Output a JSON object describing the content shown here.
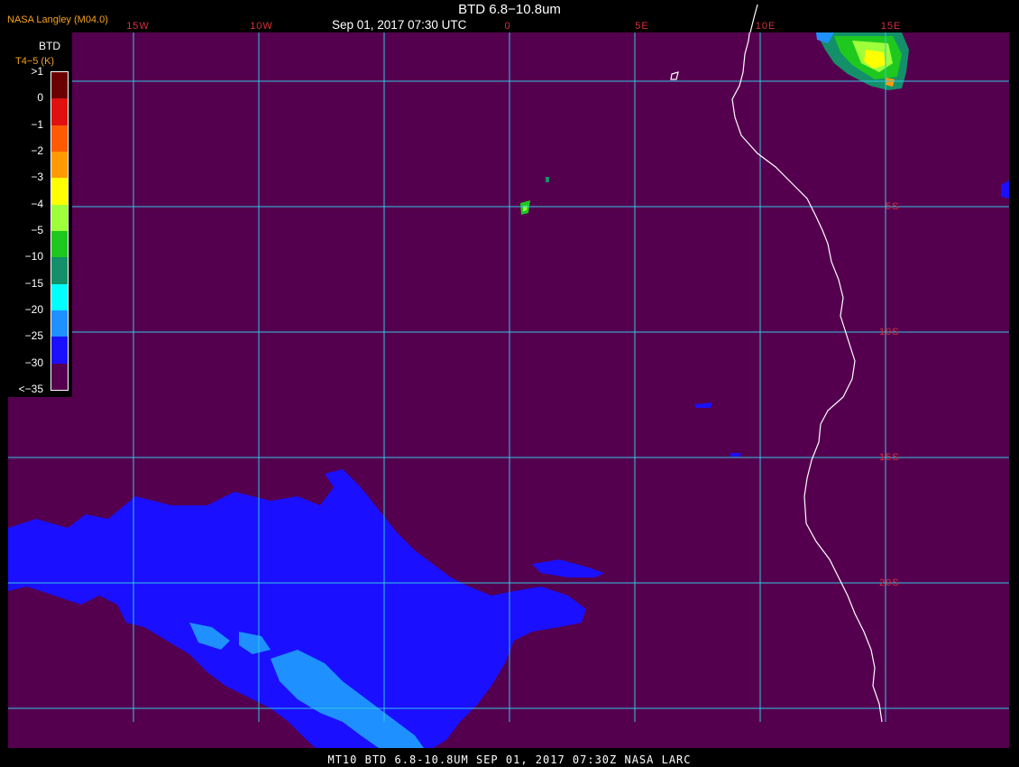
{
  "header": {
    "org": "NASA Langley (M04.0)",
    "title": "BTD 6.8−10.8um",
    "datetime": "Sep 01, 2017 07:30 UTC"
  },
  "longitude_labels": [
    "15W",
    "10W",
    "0",
    "5E",
    "10E",
    "15E"
  ],
  "latitude_labels": [
    "5S",
    "10S",
    "15S",
    "20S"
  ],
  "legend": {
    "title": "BTD",
    "units": "T4−5 (K)",
    "labels": [
      ">1",
      "0",
      "−1",
      "−2",
      "−3",
      "−4",
      "−5",
      "−10",
      "−15",
      "−20",
      "−25",
      "−30",
      "<−35"
    ],
    "colors": [
      "#6b0000",
      "#e01010",
      "#ff5a00",
      "#ff9a00",
      "#ffff00",
      "#9eff3a",
      "#1fc81f",
      "#13906a",
      "#00ffff",
      "#1e90ff",
      "#1a10ff",
      "#55004f"
    ]
  },
  "colors": {
    "background": "#55004f",
    "grid": "#33c6e0",
    "coastline": "#ffffff",
    "deep_cloud": "#1a10ff",
    "mid_cloud": "#1e90ff",
    "label_red": "#d8303a",
    "label_orange": "#f7a21a"
  },
  "footer": {
    "text": "MT10  BTD 6.8-10.8UM   SEP 01, 2017 07:30Z   NASA LARC"
  }
}
